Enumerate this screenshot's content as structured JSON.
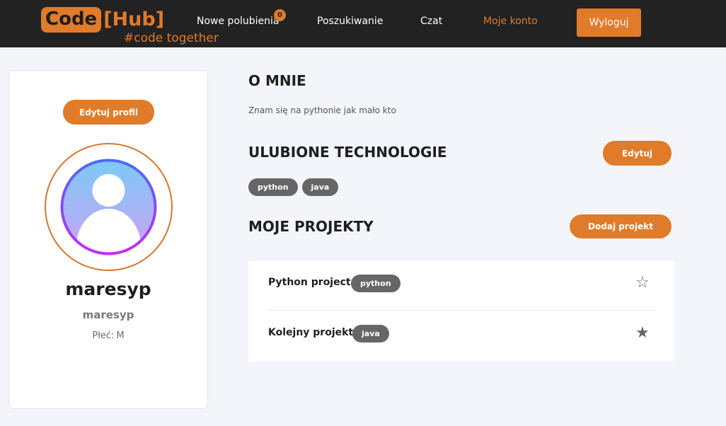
{
  "header": {
    "logo_code": "Code",
    "logo_hub": "[Hub]",
    "tagline": "#code together",
    "nav": [
      {
        "label": "Nowe polubienia"
      },
      {
        "label": "Poszukiwanie"
      },
      {
        "label": "Czat"
      },
      {
        "label": "Moje konto"
      }
    ],
    "likes_badge": "0",
    "logout_label": "Wyloguj"
  },
  "profile": {
    "edit_label": "Edytuj profil",
    "username": "maresyp",
    "login": "maresyp",
    "gender_label": "Płeć:",
    "gender_value": "M"
  },
  "about": {
    "title": "O MNIE",
    "text": "Znam się na pythonie jak mało kto"
  },
  "technologies": {
    "title": "ULUBIONE TECHNOLOGIE",
    "edit_label": "Edytuj",
    "tags": [
      "python",
      "java"
    ]
  },
  "projects": {
    "title": "MOJE PROJEKTY",
    "add_label": "Dodaj projekt",
    "items": [
      {
        "name": "Python project",
        "tag": "python",
        "star": "☆"
      },
      {
        "name": "Kolejny projekt",
        "tag": "java",
        "star": "★"
      }
    ]
  },
  "colors": {
    "accent": "#e07b2a",
    "navbar_bg": "#222222",
    "page_bg": "#f3f5fb",
    "tag_bg": "#666666"
  }
}
